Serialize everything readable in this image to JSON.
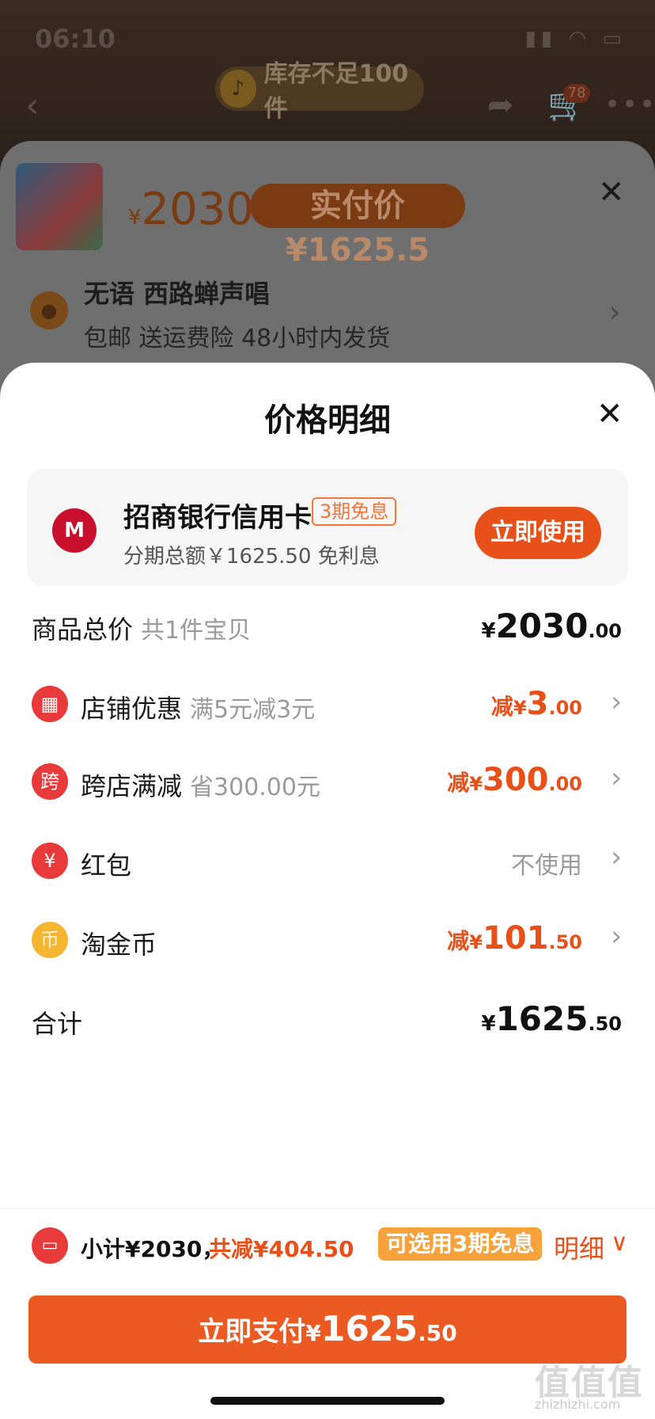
{
  "status_bar": {
    "time": "06:10"
  },
  "background_page": {
    "stock_notice": "库存不足100件",
    "cart_count": "78",
    "price_symbol": "¥",
    "price": "2030",
    "paid_price": "实付价 ¥1625.5",
    "address": "无语 西路蝉声唱",
    "shipping": "包邮 送运费险 48小时内发货"
  },
  "sheet": {
    "title": "价格明细",
    "promo": {
      "bank_name": "招商银行信用卡",
      "badge": "3期免息",
      "subtitle": "分期总额￥1625.50 免利息",
      "button": "立即使用"
    },
    "rows": [
      {
        "label": "商品总价",
        "note": "共1件宝贝",
        "prefix": "",
        "yen": "¥",
        "int": "2030",
        "dec": ".00"
      },
      {
        "label": "店铺优惠",
        "note": "满5元减3元",
        "prefix": "减",
        "yen": "¥",
        "int": "3",
        "dec": ".00",
        "icon": "store-icon"
      },
      {
        "label": "跨店满减",
        "note": "省300.00元",
        "prefix": "减",
        "yen": "¥",
        "int": "300",
        "dec": ".00",
        "icon": "kua-badge-icon",
        "icon_text": "跨"
      },
      {
        "label": "红包",
        "note": "",
        "value": "不使用",
        "icon": "red-envelope-icon",
        "icon_text": "¥"
      },
      {
        "label": "淘金币",
        "note": "",
        "prefix": "减",
        "yen": "¥",
        "int": "101",
        "dec": ".50",
        "icon": "coin-icon",
        "icon_text": "币"
      },
      {
        "label": "合计",
        "note": "",
        "prefix": "",
        "yen": "¥",
        "int": "1625",
        "dec": ".50"
      }
    ]
  },
  "footer": {
    "subtotal": "小计¥2030，",
    "saved": "共减¥404.50",
    "installment_badge": "可选用3期免息",
    "detail_link": "明细",
    "pay_label": "立即支付",
    "pay_yen": "¥",
    "pay_int": "1625",
    "pay_dec": ".50"
  },
  "watermark": {
    "main": "值值值",
    "sub": "zhizhizhi.com"
  },
  "colors": {
    "accent": "#e8501a",
    "bank_red": "#c8102e",
    "badge_orange": "#f7a23a"
  }
}
